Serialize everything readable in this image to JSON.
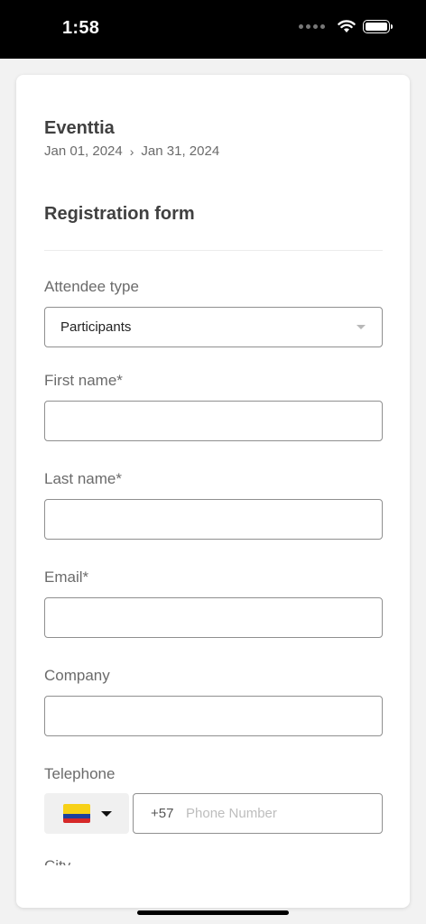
{
  "status": {
    "time": "1:58"
  },
  "event": {
    "name": "Eventtia",
    "start_date": "Jan 01, 2024",
    "end_date": "Jan 31, 2024"
  },
  "form": {
    "title": "Registration form",
    "attendee_type": {
      "label": "Attendee type",
      "value": "Participants"
    },
    "first_name": {
      "label": "First name*",
      "value": ""
    },
    "last_name": {
      "label": "Last name*",
      "value": ""
    },
    "email": {
      "label": "Email*",
      "value": ""
    },
    "company": {
      "label": "Company",
      "value": ""
    },
    "telephone": {
      "label": "Telephone",
      "country_flag": "colombia-flag",
      "dial_code": "+57",
      "placeholder": "Phone Number"
    },
    "next_field_label": "City"
  }
}
